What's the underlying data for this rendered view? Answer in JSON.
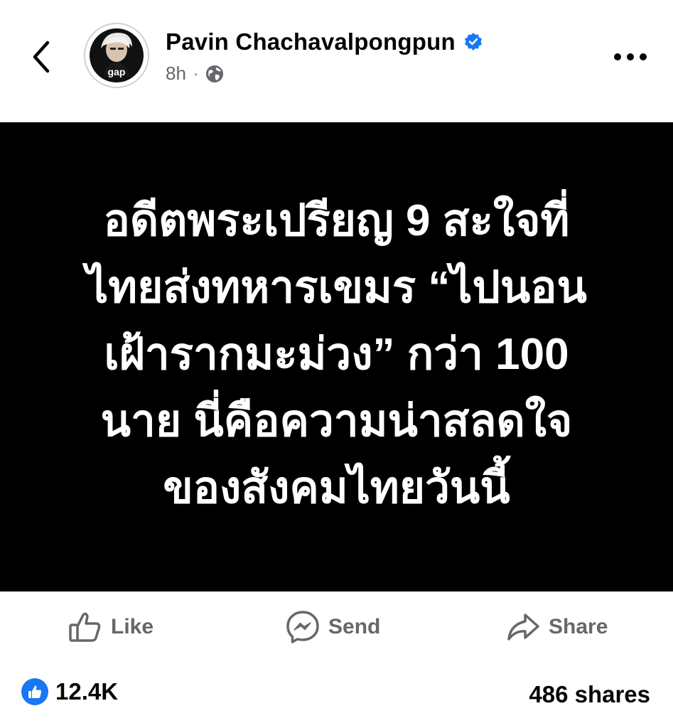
{
  "header": {
    "author_name": "Pavin Chachavalpongpun",
    "time": "8h",
    "separator": "·",
    "avatar_text": "gap"
  },
  "post": {
    "image_text": "อดีตพระเปรียญ 9 สะใจที่\nไทยส่งทหารเขมร “ไปนอน\nเฝ้ารากมะม่วง” กว่า 100\nนาย นี่คือความน่าสลดใจ\nของสังคมไทยวันนี้"
  },
  "actions": {
    "like_label": "Like",
    "send_label": "Send",
    "share_label": "Share"
  },
  "stats": {
    "reaction_count": "12.4K",
    "shares": "486 shares"
  },
  "icons": {
    "back": "chevron-left-icon",
    "verified": "verified-badge-icon",
    "privacy": "globe-icon",
    "more": "more-dots-icon",
    "like": "thumbs-up-icon",
    "send": "messenger-icon",
    "share": "share-arrow-icon"
  },
  "colors": {
    "accent": "#1877f2",
    "muted_text": "#65676b",
    "post_background": "#000000",
    "post_text": "#ffffff"
  }
}
